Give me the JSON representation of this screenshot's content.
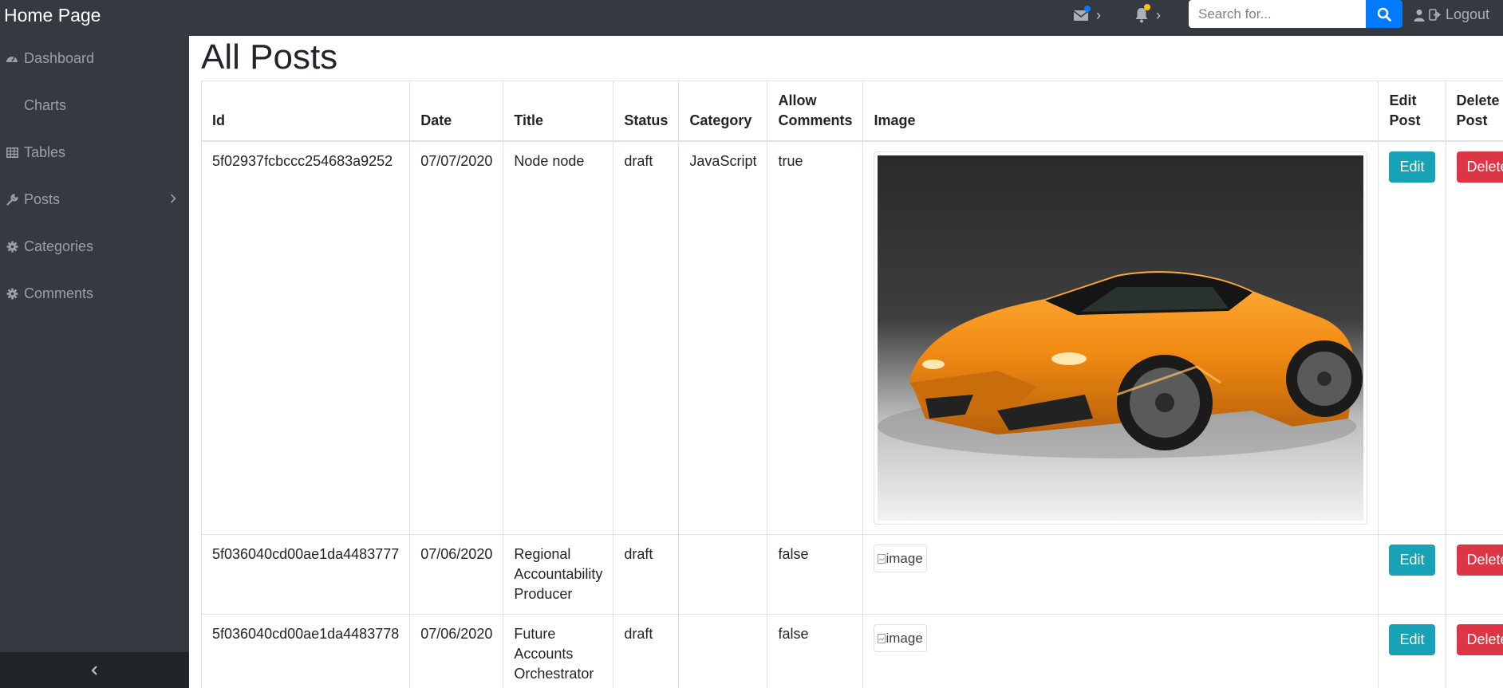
{
  "header": {
    "brand": "Home Page",
    "messages_icon": "envelope-icon",
    "alerts_icon": "bell-icon",
    "search_placeholder": "Search for...",
    "logout_label": "Logout",
    "accent": "#007bff"
  },
  "sidebar": {
    "items": [
      {
        "label": "Dashboard",
        "icon": "dashboard-icon"
      },
      {
        "label": "Charts",
        "icon": ""
      },
      {
        "label": "Tables",
        "icon": "table-icon"
      },
      {
        "label": "Posts",
        "icon": "wrench-icon"
      },
      {
        "label": "Categories",
        "icon": "cog-icon"
      },
      {
        "label": "Comments",
        "icon": "cog-icon"
      }
    ],
    "toggle_icon": "chevron-left-icon"
  },
  "main": {
    "title": "All Posts",
    "columns": [
      "Id",
      "Date",
      "Title",
      "Status",
      "Category",
      "Allow Comments",
      "Image",
      "Edit Post",
      "Delete Post"
    ],
    "rows": [
      {
        "id": "5f02937fcbccc254683a9252",
        "date": "07/07/2020",
        "title": "Node node",
        "status": "draft",
        "category": "JavaScript",
        "allow_comments": "true",
        "image": "orange sports car photo",
        "edit": "Edit",
        "delete": "Delete"
      },
      {
        "id": "5f036040cd00ae1da4483777",
        "date": "07/06/2020",
        "title": "Regional Accountability Producer",
        "status": "draft",
        "category": "",
        "allow_comments": "false",
        "image_alt": "image",
        "edit": "Edit",
        "delete": "Delete"
      },
      {
        "id": "5f036040cd00ae1da4483778",
        "date": "07/06/2020",
        "title": "Future Accounts Orchestrator",
        "status": "draft",
        "category": "",
        "allow_comments": "false",
        "image_alt": "image",
        "edit": "Edit",
        "delete": "Delete"
      }
    ]
  }
}
